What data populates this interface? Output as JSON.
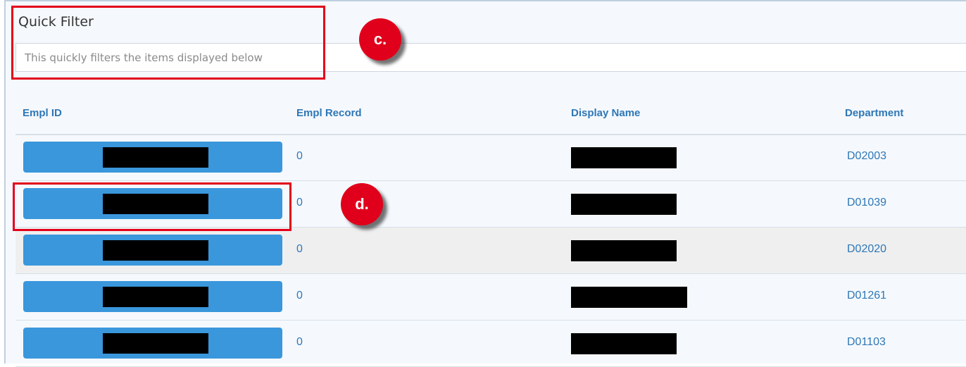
{
  "quick_filter": {
    "title": "Quick Filter",
    "placeholder": "This quickly filters the items displayed below",
    "value": ""
  },
  "table": {
    "columns": [
      "Empl ID",
      "Empl Record",
      "Display Name",
      "Department"
    ],
    "rows": [
      {
        "empl_id": "[redacted]",
        "empl_record": "0",
        "display_name": "[redacted]",
        "department": "D02003"
      },
      {
        "empl_id": "[redacted]",
        "empl_record": "0",
        "display_name": "[redacted]",
        "department": "D01039"
      },
      {
        "empl_id": "[redacted]",
        "empl_record": "0",
        "display_name": "[redacted]",
        "department": "D02020"
      },
      {
        "empl_id": "[redacted]",
        "empl_record": "0",
        "display_name": "[redacted]",
        "department": "D01261"
      },
      {
        "empl_id": "[redacted]",
        "empl_record": "0",
        "display_name": "[redacted]",
        "department": "D01103"
      }
    ]
  },
  "annotations": {
    "c": "c.",
    "d": "d."
  },
  "colors": {
    "accent_blue": "#2f77b6",
    "button_blue": "#3a97dc",
    "annotation_red": "#e3001b",
    "redaction": "#000000"
  }
}
